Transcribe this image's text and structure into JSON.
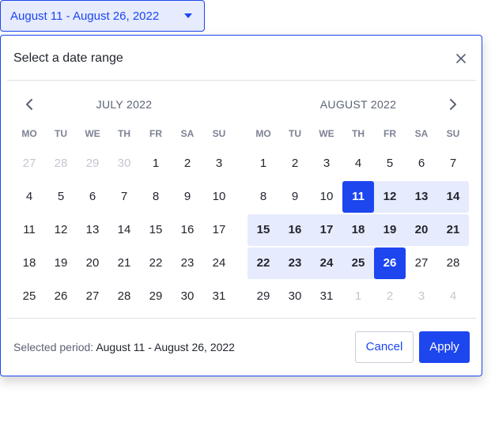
{
  "trigger": {
    "label": "August 11 - August 26, 2022",
    "caret_icon": "caret-down-icon"
  },
  "dialog": {
    "title": "Select a date range",
    "close_icon": "close-icon",
    "prev_icon": "chevron-left-icon",
    "next_icon": "chevron-right-icon"
  },
  "weekdays": [
    "MO",
    "TU",
    "WE",
    "TH",
    "FR",
    "SA",
    "SU"
  ],
  "months": [
    {
      "title": "JULY 2022",
      "weeks": [
        [
          {
            "d": "27",
            "out": true
          },
          {
            "d": "28",
            "out": true
          },
          {
            "d": "29",
            "out": true
          },
          {
            "d": "30",
            "out": true
          },
          {
            "d": "1"
          },
          {
            "d": "2"
          },
          {
            "d": "3"
          }
        ],
        [
          {
            "d": "4"
          },
          {
            "d": "5"
          },
          {
            "d": "6"
          },
          {
            "d": "7"
          },
          {
            "d": "8"
          },
          {
            "d": "9"
          },
          {
            "d": "10"
          }
        ],
        [
          {
            "d": "11"
          },
          {
            "d": "12"
          },
          {
            "d": "13"
          },
          {
            "d": "14"
          },
          {
            "d": "15"
          },
          {
            "d": "16"
          },
          {
            "d": "17"
          }
        ],
        [
          {
            "d": "18"
          },
          {
            "d": "19"
          },
          {
            "d": "20"
          },
          {
            "d": "21"
          },
          {
            "d": "22"
          },
          {
            "d": "23"
          },
          {
            "d": "24"
          }
        ],
        [
          {
            "d": "25"
          },
          {
            "d": "26"
          },
          {
            "d": "27"
          },
          {
            "d": "28"
          },
          {
            "d": "29"
          },
          {
            "d": "30"
          },
          {
            "d": "31"
          }
        ]
      ]
    },
    {
      "title": "AUGUST 2022",
      "weeks": [
        [
          {
            "d": "1"
          },
          {
            "d": "2"
          },
          {
            "d": "3"
          },
          {
            "d": "4"
          },
          {
            "d": "5"
          },
          {
            "d": "6"
          },
          {
            "d": "7"
          }
        ],
        [
          {
            "d": "8"
          },
          {
            "d": "9"
          },
          {
            "d": "10"
          },
          {
            "d": "11",
            "state": "start"
          },
          {
            "d": "12",
            "state": "in"
          },
          {
            "d": "13",
            "state": "in"
          },
          {
            "d": "14",
            "state": "in"
          }
        ],
        [
          {
            "d": "15",
            "state": "in"
          },
          {
            "d": "16",
            "state": "in"
          },
          {
            "d": "17",
            "state": "in"
          },
          {
            "d": "18",
            "state": "in"
          },
          {
            "d": "19",
            "state": "in"
          },
          {
            "d": "20",
            "state": "in"
          },
          {
            "d": "21",
            "state": "in"
          }
        ],
        [
          {
            "d": "22",
            "state": "in"
          },
          {
            "d": "23",
            "state": "in"
          },
          {
            "d": "24",
            "state": "in"
          },
          {
            "d": "25",
            "state": "in"
          },
          {
            "d": "26",
            "state": "end"
          },
          {
            "d": "27"
          },
          {
            "d": "28"
          }
        ],
        [
          {
            "d": "29"
          },
          {
            "d": "30"
          },
          {
            "d": "31"
          },
          {
            "d": "1",
            "out": true
          },
          {
            "d": "2",
            "out": true
          },
          {
            "d": "3",
            "out": true
          },
          {
            "d": "4",
            "out": true
          }
        ]
      ]
    }
  ],
  "footer": {
    "period_label": "Selected period:",
    "period_value": "August 11 - August 26, 2022",
    "cancel_label": "Cancel",
    "apply_label": "Apply"
  },
  "colors": {
    "accent": "#1d46ef",
    "range_bg": "#e6ebfd",
    "muted": "#c3c7d1"
  }
}
